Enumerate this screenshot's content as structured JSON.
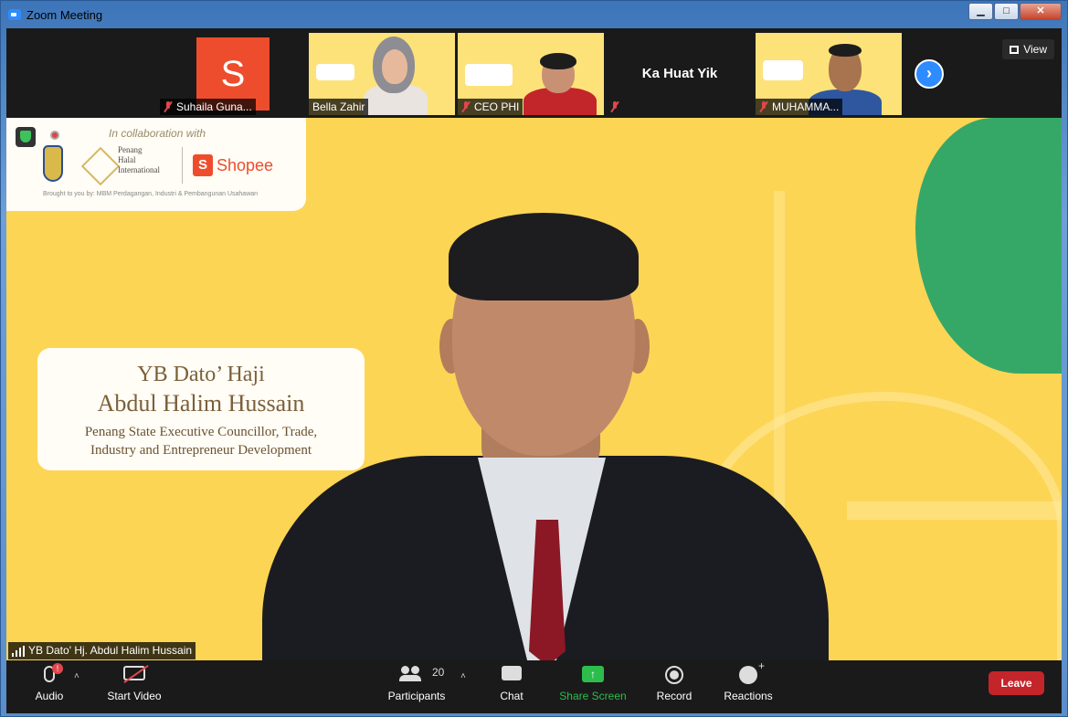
{
  "window": {
    "title": "Zoom Meeting",
    "buttons": {
      "minimize": "▁",
      "maximize": "□",
      "close": "✕"
    }
  },
  "thumbnails": [
    {
      "name": "Suhaila Guna...",
      "avatar_letter": "S",
      "muted": true,
      "video": false
    },
    {
      "name": "Bella Zahir",
      "muted": true,
      "video": true
    },
    {
      "name": "CEO PHI",
      "muted": true,
      "video": true
    },
    {
      "name": "Ka Huat Yik",
      "muted": true,
      "video": false
    },
    {
      "name": "MUHAMMA...",
      "muted": true,
      "video": true
    }
  ],
  "view_button": "View",
  "main": {
    "collab_text": "In collaboration with",
    "partner_text": "Penang\nHalal\nInternational",
    "shopee_text": "Shopee",
    "shopee_bag_letter": "S",
    "brought_text": "Brought to you by: MBM Perdagangan, Industri & Pembangunan Usahawan",
    "name_card": {
      "line1": "YB Dato’ Haji",
      "line2": "Abdul Halim Hussain",
      "line3": "Penang State Executive Councillor, Trade,",
      "line4": "Industry and Entrepreneur Development"
    },
    "speaker_label": "YB Dato' Hj. Abdul Halim Hussain"
  },
  "toolbar": {
    "audio": "Audio",
    "audio_badge": "!",
    "start_video": "Start Video",
    "participants": "Participants",
    "participants_count": "20",
    "chat": "Chat",
    "share_screen": "Share Screen",
    "record": "Record",
    "reactions": "Reactions",
    "leave": "Leave"
  },
  "colors": {
    "share_green": "#2dbd4d",
    "leave_red": "#c4252a",
    "zoom_blue": "#2d8cff",
    "shopee_orange": "#ee4d2d"
  }
}
